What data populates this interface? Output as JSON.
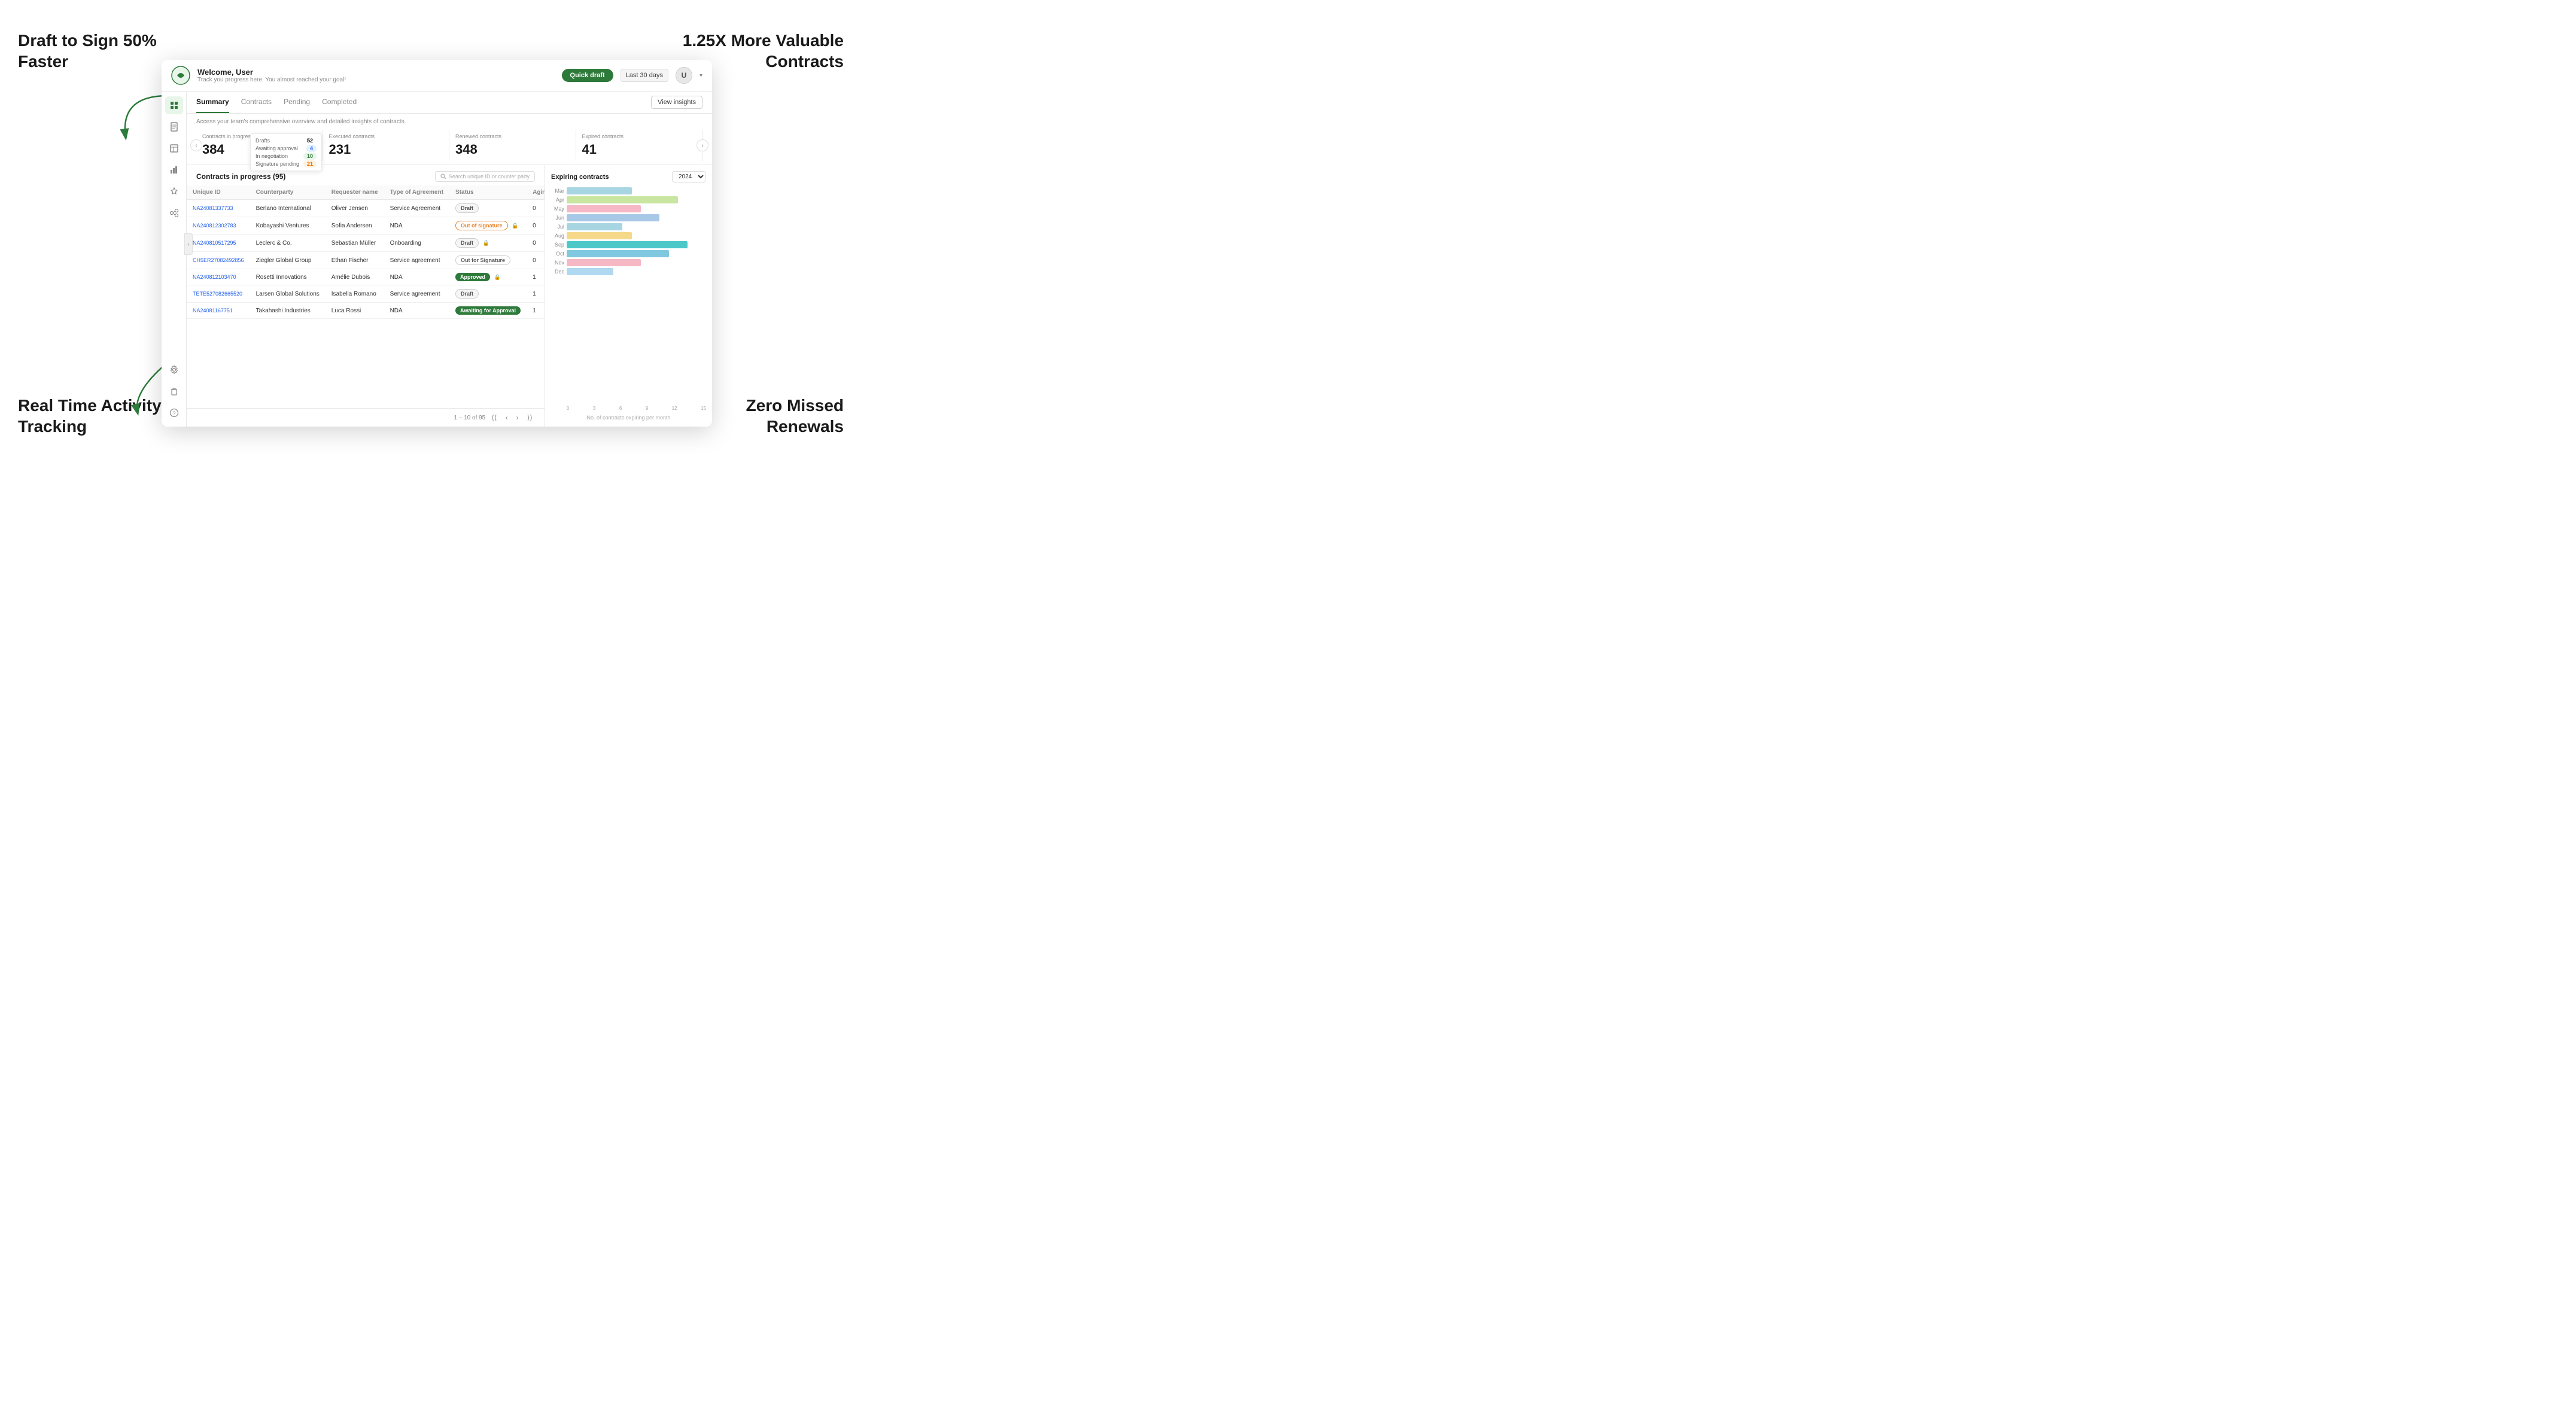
{
  "marketing": {
    "top_left": "Draft to Sign 50%\nFaster",
    "top_right": "1.25X More Valuable\nContracts",
    "bottom_left": "Real Time Activity\nTracking",
    "bottom_right": "Zero Missed\nRenewals"
  },
  "header": {
    "welcome": "Welcome, User",
    "subtitle": "Track you progress here. You almost reached your goal!",
    "quick_draft": "Quick draft",
    "date_filter": "Last 30 days",
    "user_initial": "U"
  },
  "tabs": [
    "Summary",
    "Contracts",
    "Pending",
    "Completed"
  ],
  "active_tab": "Summary",
  "view_insights": "View insights",
  "summary": {
    "description": "Access your team's comprehensive overview and detailed insights of contracts.",
    "stats": [
      {
        "label": "Contracts in progress",
        "value": "384",
        "breakdown": true,
        "breakdown_items": [
          {
            "label": "Drafts",
            "val": "52",
            "cls": ""
          },
          {
            "label": "Awaiting approval",
            "val": "4",
            "cls": "bd-blue"
          },
          {
            "label": "In negotiation",
            "val": "10",
            "cls": "bd-green"
          },
          {
            "label": "Signature pending",
            "val": "21",
            "cls": "bd-orange"
          }
        ]
      },
      {
        "label": "Executed contracts",
        "value": "231"
      },
      {
        "label": "Renewed contracts",
        "value": "348"
      },
      {
        "label": "Expired contracts",
        "value": "41"
      }
    ]
  },
  "contracts_table": {
    "title": "Contracts in progress (95)",
    "search_placeholder": "Search unique ID or counter party",
    "columns": [
      "Unique ID",
      "Counterparty",
      "Requester name",
      "Type of Agreement",
      "Status",
      "Aging"
    ],
    "rows": [
      {
        "id": "NA24081337733",
        "counterparty": "Berlano International",
        "requester": "Oliver Jensen",
        "type": "Service Agreement",
        "status": "Draft",
        "status_cls": "badge-draft",
        "aging": "0"
      },
      {
        "id": "NA240812302783",
        "counterparty": "Kobayashi Ventures",
        "requester": "Sofia Andersen",
        "type": "NDA",
        "status": "Out of signature",
        "status_cls": "badge-out-sig",
        "aging": "0",
        "lock": true
      },
      {
        "id": "NA240810517295",
        "counterparty": "Leclerc & Co.",
        "requester": "Sebastian Müller",
        "type": "Onboarding",
        "status": "Draft",
        "status_cls": "badge-draft",
        "aging": "0",
        "lock": true
      },
      {
        "id": "CH5ER27082492856",
        "counterparty": "Ziegler Global Group",
        "requester": "Ethan Fischer",
        "type": "Service agreement",
        "status": "Out for Signature",
        "status_cls": "badge-out-for-sig",
        "aging": "0"
      },
      {
        "id": "NA240812103470",
        "counterparty": "Rosetti Innovations",
        "requester": "Amélie Dubois",
        "type": "NDA",
        "status": "Approved",
        "status_cls": "badge-approved",
        "aging": "1",
        "lock": true
      },
      {
        "id": "TETE527082665520",
        "counterparty": "Larsen Global Solutions",
        "requester": "Isabella Romano",
        "type": "Service agreement",
        "status": "Draft",
        "status_cls": "badge-draft",
        "aging": "1"
      },
      {
        "id": "NA24081167751",
        "counterparty": "Takahashi Industries",
        "requester": "Luca Rossi",
        "type": "NDA",
        "status": "Awaiting for Approval",
        "status_cls": "badge-awaiting",
        "aging": "1"
      }
    ],
    "pagination": "1 – 10 of 95"
  },
  "chart": {
    "title": "Expiring contracts",
    "year": "2024",
    "footer": "No. of contracts expiring per month",
    "x_labels": [
      "0",
      "3",
      "6",
      "9",
      "12",
      "15"
    ],
    "bars": [
      {
        "month": "Mar",
        "values": [
          {
            "val": 7,
            "color": "#a8d5e2"
          },
          {
            "val": 0,
            "color": ""
          }
        ]
      },
      {
        "month": "Apr",
        "values": [
          {
            "val": 12,
            "color": "#c8e6a0"
          },
          {
            "val": 0,
            "color": ""
          }
        ]
      },
      {
        "month": "May",
        "values": [
          {
            "val": 8,
            "color": "#f5b8c4"
          },
          {
            "val": 0,
            "color": ""
          }
        ]
      },
      {
        "month": "Jun",
        "values": [
          {
            "val": 10,
            "color": "#a8d5e2"
          },
          {
            "val": 0,
            "color": ""
          }
        ]
      },
      {
        "month": "Jul",
        "values": [
          {
            "val": 6,
            "color": "#a8d5e2"
          },
          {
            "val": 0,
            "color": ""
          }
        ]
      },
      {
        "month": "Aug",
        "values": [
          {
            "val": 7,
            "color": "#f5d58a"
          },
          {
            "val": 0,
            "color": ""
          }
        ]
      },
      {
        "month": "Sep",
        "values": [
          {
            "val": 13,
            "color": "#4dc8c8"
          },
          {
            "val": 0,
            "color": ""
          }
        ]
      },
      {
        "month": "Oct",
        "values": [
          {
            "val": 11,
            "color": "#80c8e0"
          },
          {
            "val": 0,
            "color": ""
          }
        ]
      },
      {
        "month": "Nov",
        "values": [
          {
            "val": 8,
            "color": "#f5b8c4"
          },
          {
            "val": 0,
            "color": ""
          }
        ]
      },
      {
        "month": "Dec",
        "values": [
          {
            "val": 5,
            "color": "#a8d5e2"
          },
          {
            "val": 0,
            "color": ""
          }
        ]
      }
    ],
    "max_val": 15
  },
  "sidebar": {
    "icons": [
      "📄",
      "📋",
      "📁",
      "⚙️",
      "🗑️"
    ],
    "bottom_icons": [
      "⚙️",
      "🗑️",
      "❓"
    ]
  }
}
